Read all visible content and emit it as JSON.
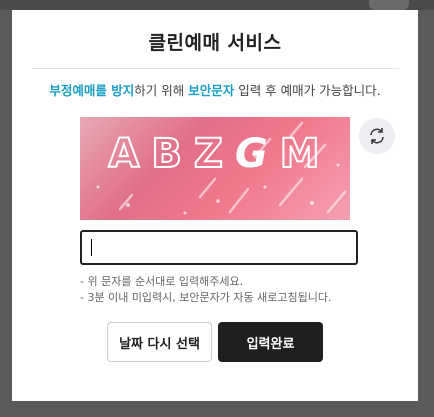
{
  "modal": {
    "title": "클린예매 서비스",
    "description": {
      "part1": "부정예매를 방지",
      "part2": "하기 위해 ",
      "part3": "보안문자",
      "part4": " 입력 후 예매가 가능합니다.",
      "highlight_color": "#1a9fc4"
    },
    "captcha": {
      "chars": [
        "A",
        "B",
        "Z",
        "G",
        "M"
      ],
      "refresh_icon": "refresh-icon"
    },
    "input": {
      "value": "",
      "placeholder": ""
    },
    "notes": [
      "- 위 문자를 순서대로 입력해주세요.",
      "- 3분 이내 미입력시, 보안문자가 자동 새로고침됩니다."
    ],
    "buttons": {
      "reselect_date": "날짜 다시 선택",
      "submit": "입력완료"
    }
  }
}
